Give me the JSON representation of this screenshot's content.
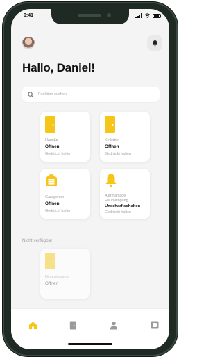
{
  "status_bar": {
    "time": "9:41",
    "icons": [
      "signal-icon",
      "wifi-icon",
      "battery-icon"
    ]
  },
  "header": {
    "avatar": "user-avatar",
    "notification_icon": "bell-icon"
  },
  "greeting": "Hallo, Daniel!",
  "search": {
    "placeholder": "Funktion suchen",
    "icon": "search-icon"
  },
  "tiles": [
    {
      "name": "Haustür",
      "action": "Öffnen",
      "hint": "Gedrückt halten",
      "icon": "door-icon"
    },
    {
      "name": "Kellertür",
      "action": "Öffnen",
      "hint": "Gedrückt halten",
      "icon": "door-icon"
    },
    {
      "name": "Garagentor",
      "action": "Öffnen",
      "hint": "Gedrückt halten",
      "icon": "garage-icon"
    },
    {
      "name": "Alarmanlage Haupteingang",
      "action": "Unscharf schalten",
      "hint": "Gedrückt halten",
      "icon": "bell-icon"
    }
  ],
  "unavailable": {
    "label": "Nicht verfügbar",
    "tiles": [
      {
        "name": "Hintereingang",
        "action": "Öffnen",
        "icon": "door-icon"
      }
    ]
  },
  "tabbar": {
    "items": [
      "home-icon",
      "door-icon",
      "person-icon",
      "settings-icon"
    ],
    "active": "home-icon"
  },
  "colors": {
    "accent": "#F5C518",
    "accent_disabled": "#F7E08A",
    "background": "#F4F4F4",
    "text": "#111111"
  }
}
